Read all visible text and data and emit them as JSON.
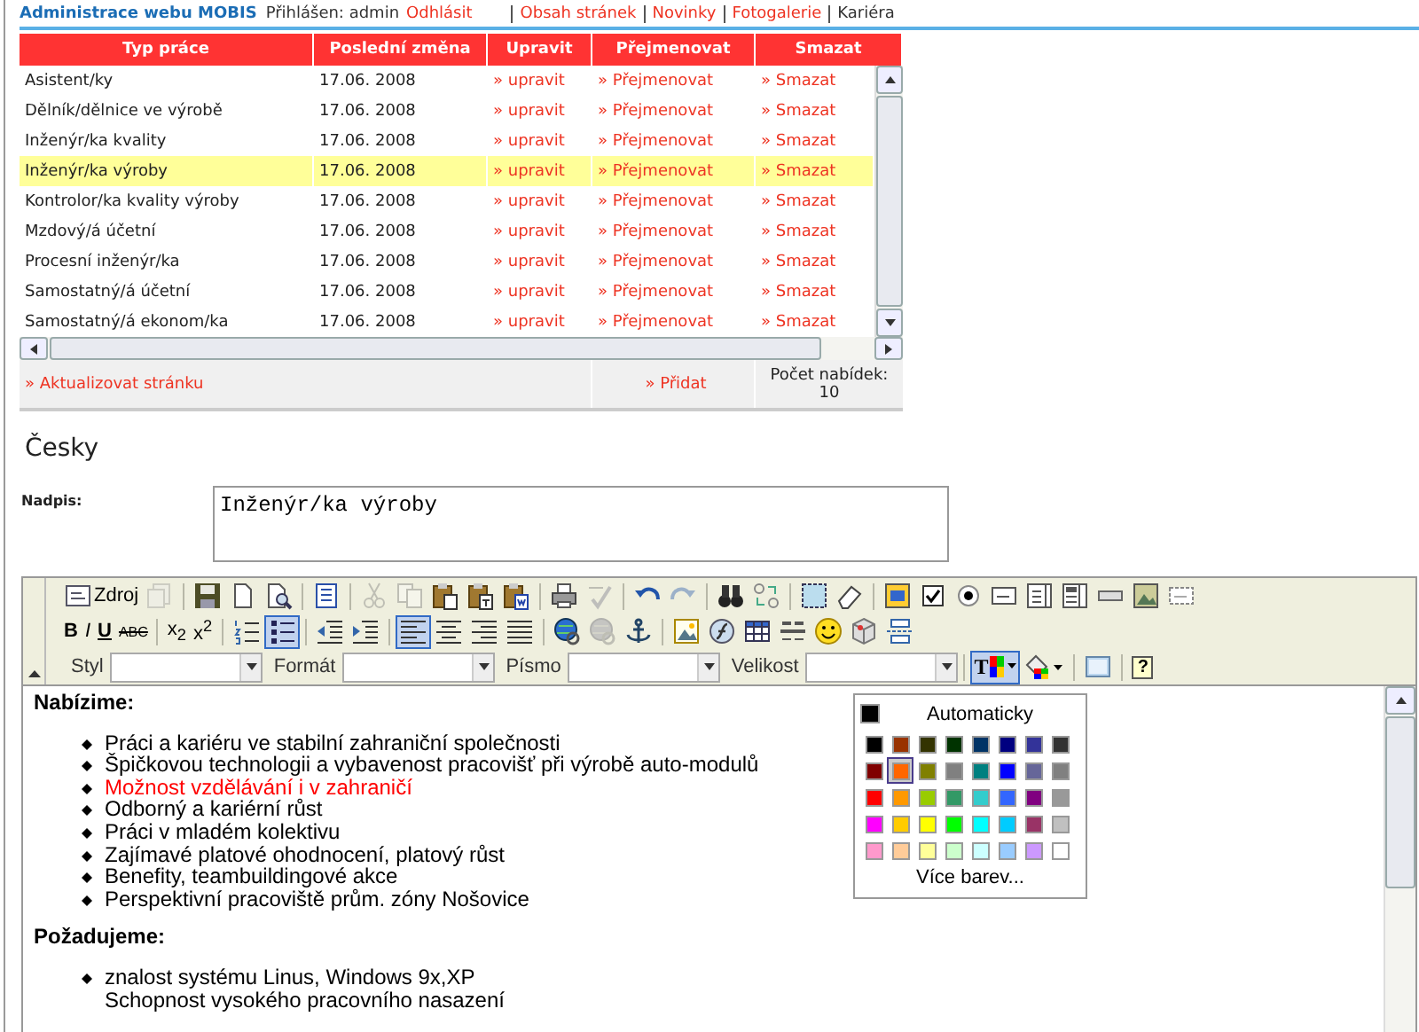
{
  "header": {
    "title": "Administrace webu MOBIS",
    "login": "Přihlášen: admin",
    "logout": "Odhlásit",
    "nav": [
      {
        "label": "Obsah stránek",
        "selected": false
      },
      {
        "label": "Novinky",
        "selected": false
      },
      {
        "label": "Fotogalerie",
        "selected": false
      },
      {
        "label": "Kariéra",
        "selected": true
      }
    ]
  },
  "table": {
    "columns": [
      "Typ práce",
      "Poslední změna",
      "Upravit",
      "Přejmenovat",
      "Smazat"
    ],
    "rows": [
      {
        "cells": [
          "Asistent/ky",
          "17.06. 2008"
        ],
        "actions": [
          "» upravit",
          "» Přejmenovat",
          "» Smazat"
        ],
        "selected": false
      },
      {
        "cells": [
          "Dělník/dělnice ve výrobě",
          "17.06. 2008"
        ],
        "actions": [
          "» upravit",
          "» Přejmenovat",
          "» Smazat"
        ],
        "selected": false
      },
      {
        "cells": [
          "Inženýr/ka kvality",
          "17.06. 2008"
        ],
        "actions": [
          "» upravit",
          "» Přejmenovat",
          "» Smazat"
        ],
        "selected": false
      },
      {
        "cells": [
          "Inženýr/ka výroby",
          "17.06. 2008"
        ],
        "actions": [
          "» upravit",
          "» Přejmenovat",
          "» Smazat"
        ],
        "selected": true
      },
      {
        "cells": [
          "Kontrolor/ka kvality výroby",
          "17.06. 2008"
        ],
        "actions": [
          "» upravit",
          "» Přejmenovat",
          "» Smazat"
        ],
        "selected": false
      },
      {
        "cells": [
          "Mzdový/á účetní",
          "17.06. 2008"
        ],
        "actions": [
          "» upravit",
          "» Přejmenovat",
          "» Smazat"
        ],
        "selected": false
      },
      {
        "cells": [
          "Procesní inženýr/ka",
          "17.06. 2008"
        ],
        "actions": [
          "» upravit",
          "» Přejmenovat",
          "» Smazat"
        ],
        "selected": false
      },
      {
        "cells": [
          "Samostatný/á účetní",
          "17.06. 2008"
        ],
        "actions": [
          "» upravit",
          "» Přejmenovat",
          "» Smazat"
        ],
        "selected": false
      },
      {
        "cells": [
          "Samostatný/á ekonom/ka",
          "17.06. 2008"
        ],
        "actions": [
          "» upravit",
          "» Přejmenovat",
          "» Smazat"
        ],
        "selected": false
      }
    ],
    "footer": {
      "refresh": "» Aktualizovat stránku",
      "add": "» Přidat",
      "count_label": "Počet nabídek:",
      "count": "10"
    }
  },
  "section_title": "Česky",
  "title_field": {
    "label": "Nadpis:",
    "value": "Inženýr/ka výroby"
  },
  "editor": {
    "toolbar": [
      [
        {
          "kind": "button",
          "label": "Zdroj",
          "active": false,
          "disabled": false
        },
        {
          "kind": "button",
          "active": false,
          "disabled": true
        },
        {
          "kind": "separator"
        },
        {
          "kind": "button",
          "active": false,
          "disabled": false
        },
        {
          "kind": "button",
          "active": false,
          "disabled": false
        },
        {
          "kind": "button",
          "active": false,
          "disabled": false
        },
        {
          "kind": "separator"
        },
        {
          "kind": "button",
          "active": false,
          "disabled": false
        },
        {
          "kind": "separator"
        },
        {
          "kind": "button",
          "active": false,
          "disabled": true
        },
        {
          "kind": "button",
          "active": false,
          "disabled": true
        },
        {
          "kind": "button",
          "active": false,
          "disabled": false
        },
        {
          "kind": "button",
          "active": false,
          "disabled": false
        },
        {
          "kind": "button",
          "active": false,
          "disabled": false
        },
        {
          "kind": "separator"
        },
        {
          "kind": "button",
          "active": false,
          "disabled": false
        },
        {
          "kind": "button",
          "active": false,
          "disabled": true
        },
        {
          "kind": "separator"
        },
        {
          "kind": "button",
          "active": false,
          "disabled": false
        },
        {
          "kind": "button",
          "active": false,
          "disabled": true
        },
        {
          "kind": "separator"
        },
        {
          "kind": "button",
          "active": false,
          "disabled": false
        },
        {
          "kind": "button",
          "active": false,
          "disabled": false
        },
        {
          "kind": "separator"
        },
        {
          "kind": "button",
          "active": false,
          "disabled": false
        },
        {
          "kind": "button",
          "active": false,
          "disabled": false
        },
        {
          "kind": "separator"
        },
        {
          "kind": "button",
          "active": false,
          "disabled": false
        },
        {
          "kind": "button",
          "active": false,
          "disabled": false
        },
        {
          "kind": "button",
          "active": false,
          "disabled": false
        },
        {
          "kind": "button",
          "active": false,
          "disabled": false
        },
        {
          "kind": "button",
          "active": false,
          "disabled": false
        },
        {
          "kind": "button",
          "active": false,
          "disabled": false
        },
        {
          "kind": "button",
          "active": false,
          "disabled": false
        },
        {
          "kind": "button",
          "active": false,
          "disabled": false
        },
        {
          "kind": "button",
          "active": false,
          "disabled": false
        }
      ],
      [
        {
          "kind": "button",
          "label": "B",
          "active": false,
          "disabled": false
        },
        {
          "kind": "button",
          "label": "I",
          "active": false,
          "disabled": false
        },
        {
          "kind": "button",
          "label": "U",
          "active": false,
          "disabled": false
        },
        {
          "kind": "button",
          "label": "ABC",
          "active": false,
          "disabled": false
        },
        {
          "kind": "separator"
        },
        {
          "kind": "button",
          "label": "x$_{2}$",
          "active": false,
          "disabled": false
        },
        {
          "kind": "button",
          "label": "x$^{2}$",
          "active": false,
          "disabled": false
        },
        {
          "kind": "separator"
        },
        {
          "kind": "button",
          "active": false,
          "disabled": false
        },
        {
          "kind": "button",
          "active": true,
          "disabled": false
        },
        {
          "kind": "separator"
        },
        {
          "kind": "button",
          "active": false,
          "disabled": false
        },
        {
          "kind": "button",
          "active": false,
          "disabled": false
        },
        {
          "kind": "separator"
        },
        {
          "kind": "button",
          "active": true,
          "disabled": false
        },
        {
          "kind": "button",
          "active": false,
          "disabled": false
        },
        {
          "kind": "button",
          "active": false,
          "disabled": false
        },
        {
          "kind": "button",
          "active": false,
          "disabled": false
        },
        {
          "kind": "separator"
        },
        {
          "kind": "button",
          "active": false,
          "disabled": false
        },
        {
          "kind": "button",
          "active": false,
          "disabled": true
        },
        {
          "kind": "button",
          "active": false,
          "disabled": false
        },
        {
          "kind": "separator"
        },
        {
          "kind": "button",
          "active": false,
          "disabled": false
        },
        {
          "kind": "button",
          "active": false,
          "disabled": false
        },
        {
          "kind": "button",
          "active": false,
          "disabled": false
        },
        {
          "kind": "button",
          "active": false,
          "disabled": false
        },
        {
          "kind": "button",
          "active": false,
          "disabled": false
        },
        {
          "kind": "button",
          "active": false,
          "disabled": false
        },
        {
          "kind": "button",
          "active": false,
          "disabled": false
        }
      ],
      [
        {
          "kind": "combo",
          "label": "Styl"
        },
        {
          "kind": "combo",
          "label": "Formát"
        },
        {
          "kind": "combo",
          "label": "Písmo"
        },
        {
          "kind": "combo",
          "label": "Velikost"
        },
        {
          "kind": "separator"
        },
        {
          "kind": "button",
          "label": "T",
          "active": true,
          "disabled": false
        },
        {
          "kind": "button",
          "active": false,
          "disabled": false
        },
        {
          "kind": "separator"
        },
        {
          "kind": "button",
          "active": false,
          "disabled": false
        },
        {
          "kind": "separator"
        },
        {
          "kind": "button",
          "label": "?",
          "active": false,
          "disabled": false
        }
      ]
    ],
    "content": [
      {
        "kind": "heading",
        "text": "Nabízime:"
      },
      {
        "kind": "list",
        "items": [
          {
            "lines": [
              "Práci a kariéru ve stabilní zahraniční společnosti"
            ],
            "color": "#000000"
          },
          {
            "lines": [
              "Špičkovou technologii a vybavenost pracovišť při výrobě auto-modulů"
            ],
            "color": "#000000"
          },
          {
            "lines": [
              "Možnost vzdělávání i v zahraničí"
            ],
            "color": "#ff0000"
          },
          {
            "lines": [
              "Odborný a kariérní růst"
            ],
            "color": "#000000"
          },
          {
            "lines": [
              "Práci v mladém kolektivu"
            ],
            "color": "#000000"
          },
          {
            "lines": [
              "Zajímavé platové ohodnocení, platový růst"
            ],
            "color": "#000000"
          },
          {
            "lines": [
              "Benefity, teambuildingové akce"
            ],
            "color": "#000000"
          },
          {
            "lines": [
              "Perspektivní pracoviště prům. zóny Nošovice"
            ],
            "color": "#000000"
          }
        ]
      },
      {
        "kind": "heading",
        "text": "Požadujeme:"
      },
      {
        "kind": "list",
        "items": [
          {
            "lines": [
              "znalost systému Linus, Windows 9x,XP",
              "Schopnost vysokého pracovního nasazení"
            ],
            "color": "#000000"
          }
        ]
      }
    ],
    "color_menu": {
      "automatic": {
        "label": "Automaticky",
        "color": "#000000"
      },
      "more": "Více barev...",
      "swatches": [
        {
          "color": "#000000",
          "selected": false
        },
        {
          "color": "#993300",
          "selected": false
        },
        {
          "color": "#333300",
          "selected": false
        },
        {
          "color": "#003300",
          "selected": false
        },
        {
          "color": "#003366",
          "selected": false
        },
        {
          "color": "#000080",
          "selected": false
        },
        {
          "color": "#333399",
          "selected": false
        },
        {
          "color": "#333333",
          "selected": false
        },
        {
          "color": "#800000",
          "selected": false
        },
        {
          "color": "#ff6600",
          "selected": true
        },
        {
          "color": "#808000",
          "selected": false
        },
        {
          "color": "#808080",
          "selected": false
        },
        {
          "color": "#008080",
          "selected": false
        },
        {
          "color": "#0000ff",
          "selected": false
        },
        {
          "color": "#666699",
          "selected": false
        },
        {
          "color": "#808080",
          "selected": false
        },
        {
          "color": "#ff0000",
          "selected": false
        },
        {
          "color": "#ff9900",
          "selected": false
        },
        {
          "color": "#99cc00",
          "selected": false
        },
        {
          "color": "#339966",
          "selected": false
        },
        {
          "color": "#33cccc",
          "selected": false
        },
        {
          "color": "#3366ff",
          "selected": false
        },
        {
          "color": "#800080",
          "selected": false
        },
        {
          "color": "#999999",
          "selected": false
        },
        {
          "color": "#ff00ff",
          "selected": false
        },
        {
          "color": "#ffcc00",
          "selected": false
        },
        {
          "color": "#ffff00",
          "selected": false
        },
        {
          "color": "#00ff00",
          "selected": false
        },
        {
          "color": "#00ffff",
          "selected": false
        },
        {
          "color": "#00ccff",
          "selected": false
        },
        {
          "color": "#993366",
          "selected": false
        },
        {
          "color": "#c0c0c0",
          "selected": false
        },
        {
          "color": "#ff99cc",
          "selected": false
        },
        {
          "color": "#ffcc99",
          "selected": false
        },
        {
          "color": "#ffff99",
          "selected": false
        },
        {
          "color": "#ccffcc",
          "selected": false
        },
        {
          "color": "#ccffff",
          "selected": false
        },
        {
          "color": "#99ccff",
          "selected": false
        },
        {
          "color": "#cc99ff",
          "selected": false
        },
        {
          "color": "#ffffff",
          "selected": false
        }
      ]
    }
  }
}
